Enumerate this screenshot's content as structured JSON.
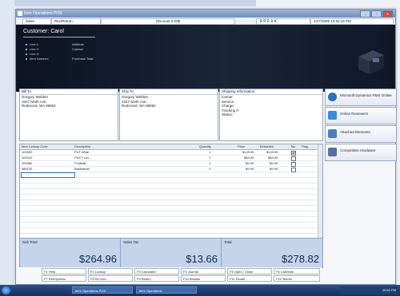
{
  "window": {
    "title": "Item Operations POS"
  },
  "menubar": {
    "items": [
      "Sales",
      "Rec/Return",
      "Discount 0.00$",
      "ＢＲＥＡＫ",
      "12/7/2009 10:52:16 PM"
    ]
  },
  "customer": {
    "label": "Customer: Carol",
    "details": [
      {
        "label": "Line 1:",
        "value": "Attribute"
      },
      {
        "label": "Line 2:",
        "value": "Contact"
      },
      {
        "label": "Line 3:",
        "value": ""
      },
      {
        "label": "Item Number:",
        "value": "Purchase Total"
      }
    ]
  },
  "bill_to": {
    "heading": "Bill To",
    "lines": [
      "Gregory Webber",
      "1047 Ninth Ave.",
      "Redmond, WA  98052"
    ]
  },
  "ship_to": {
    "heading": "Ship To",
    "lines": [
      "Gregory Webber",
      "1047 Ninth Ave.",
      "Redmond, WA  98052"
    ]
  },
  "shipping": {
    "heading": "Shipping Information",
    "lines": [
      "Carrier:",
      "Service:",
      "Charge:",
      "Tracking #:",
      "Status:"
    ]
  },
  "items": {
    "columns": [
      "Item Lookup Code",
      "Description",
      "Quantity",
      "Price",
      "Extended",
      "Tax",
      "Flag"
    ],
    "rows": [
      {
        "code": "100300",
        "desc": "PUT Wide",
        "qty": "1",
        "price": "$149.99",
        "ext": "$149.99",
        "tax": true
      },
      {
        "code": "100310",
        "desc": "PUCT  Lec",
        "qty": "1",
        "price": "$84.99",
        "ext": "$84.99",
        "tax": true
      },
      {
        "code": "100380",
        "desc": "Football",
        "qty": "1",
        "price": "$9.99",
        "ext": "$9.99",
        "tax": true
      },
      {
        "code": "980130",
        "desc": "Basketball",
        "qty": "1",
        "price": "$9.99",
        "ext": "$9.99",
        "tax": true
      }
    ]
  },
  "side_buttons": [
    {
      "label": "Microsoft Dynamics RMS Online",
      "icon": "globe-icon",
      "color": "#2f6fb7"
    },
    {
      "label": "Online Reviewers",
      "icon": "people-icon",
      "color": "#3b8bd8"
    },
    {
      "label": "Attached Elements",
      "icon": "document-icon",
      "color": "#4f7fbf"
    },
    {
      "label": "Competitive Hardware",
      "icon": "hardware-icon",
      "color": "#5a6fa0"
    }
  ],
  "totals": [
    {
      "label": "Sub Total",
      "value": "$264.96"
    },
    {
      "label": "Sales Tax",
      "value": "$13.66"
    },
    {
      "label": "Total",
      "value": "$278.82"
    }
  ],
  "fkeys": [
    [
      "F1 Help",
      "F2 Lookup",
      "F3 Calculator",
      "F4 Journal",
      "F5 Open / Close",
      "F6 Calendar"
    ],
    [
      "F7 Ref/Options",
      "F8 Re-Gen",
      "F9 Return",
      "F10 Browse",
      "F11 Recall",
      "F12 Tender"
    ]
  ],
  "taskbar": {
    "items": [
      "Item Operations POS",
      "Item Operations"
    ],
    "clock": "10:52 PM"
  },
  "colors": {
    "accent": "#2f6fb7",
    "banner": "#101828",
    "totals_bg": "#c4d4ea"
  }
}
